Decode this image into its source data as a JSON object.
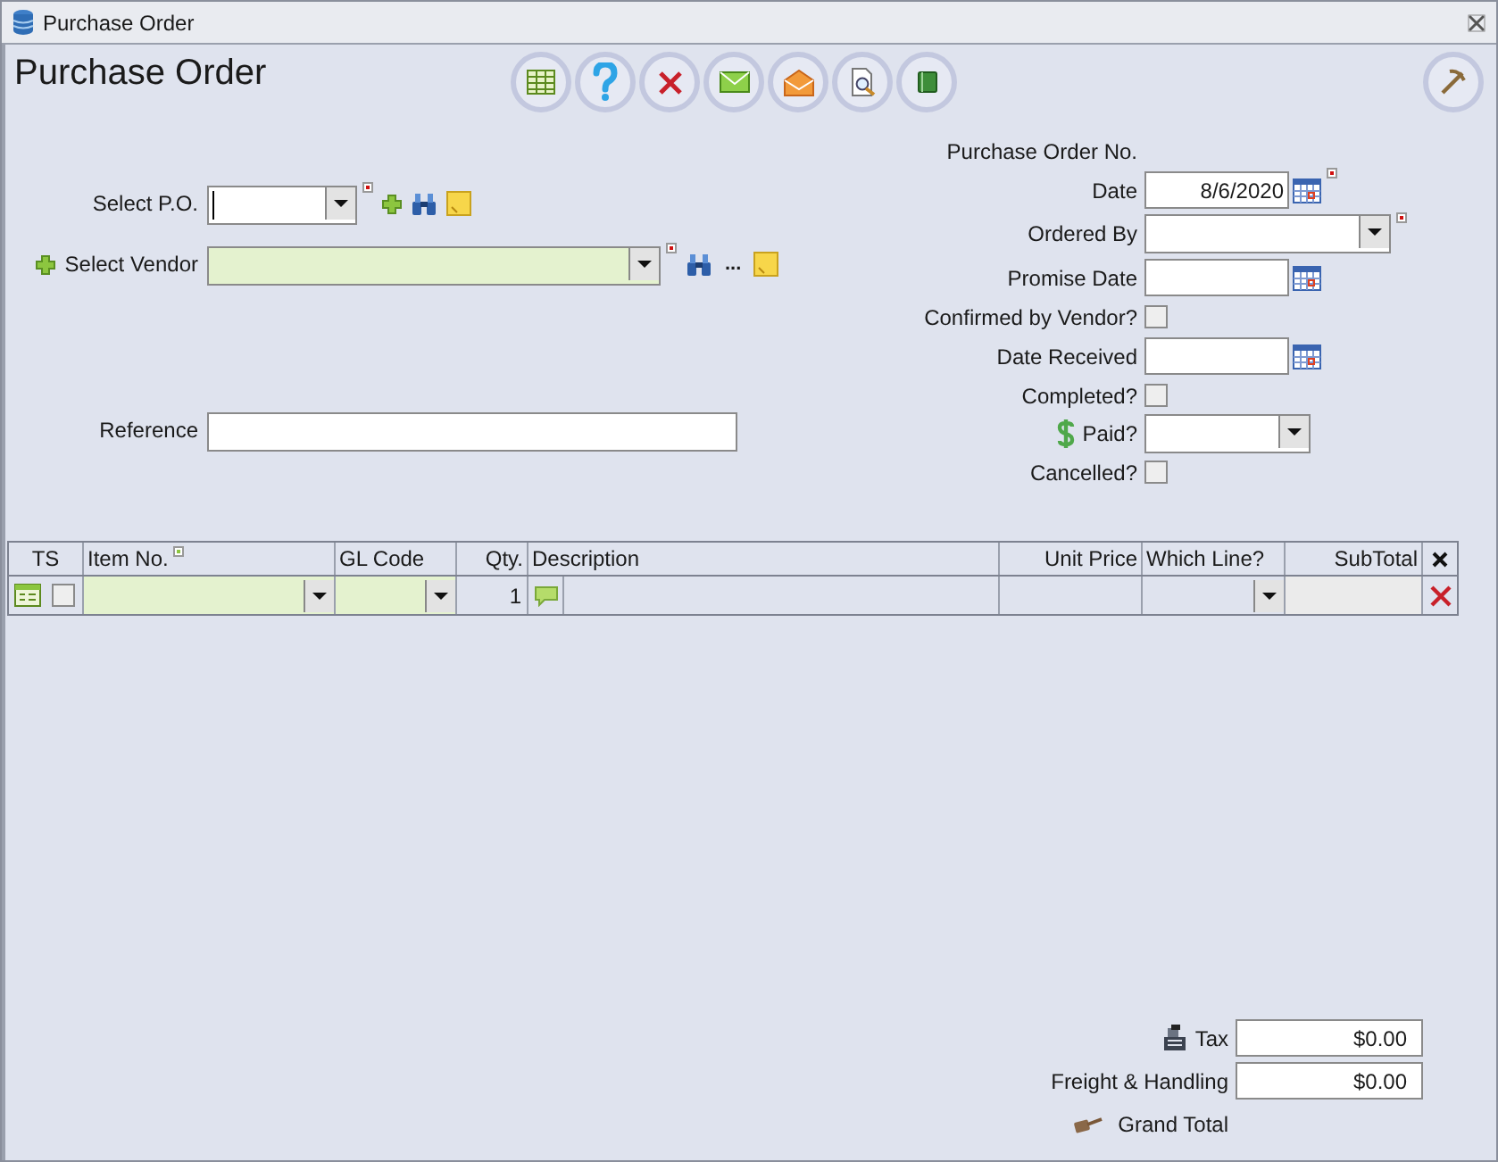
{
  "window": {
    "title": "Purchase Order"
  },
  "header": {
    "title": "Purchase Order"
  },
  "left_fields": [
    {
      "label": "Select P.O.",
      "kind": "combo",
      "required": true,
      "highlighted": false
    },
    {
      "label": "Select Vendor",
      "kind": "combo",
      "required": true,
      "highlighted": true,
      "more": "..."
    },
    {
      "label": "Reference",
      "kind": "text",
      "required": false,
      "highlighted": false
    }
  ],
  "right_fields": [
    {
      "label": "Purchase Order No.",
      "kind": "caption"
    },
    {
      "label": "Date",
      "kind": "date",
      "value": "8/6/2020",
      "required": true
    },
    {
      "label": "Ordered By",
      "kind": "combo",
      "required": true
    },
    {
      "label": "Promise Date",
      "kind": "date",
      "required": false
    },
    {
      "label": "Confirmed by Vendor?",
      "kind": "checkbox",
      "checked": false
    },
    {
      "label": "Date Received",
      "kind": "date",
      "required": false
    },
    {
      "label": "Completed?",
      "kind": "checkbox",
      "checked": false
    },
    {
      "label": "Paid?",
      "kind": "combo",
      "required": false
    },
    {
      "label": "Cancelled?",
      "kind": "checkbox",
      "checked": false
    }
  ],
  "grid": {
    "columns": [
      "TS",
      "Item No.",
      "GL Code",
      "Qty.",
      "Description",
      "Unit Price",
      "Which Line?",
      "SubTotal"
    ],
    "rows": [
      {
        "checked": false,
        "qty": "1"
      }
    ]
  },
  "totals": [
    {
      "label": "Tax",
      "value": "$0.00"
    },
    {
      "label": "Freight & Handling",
      "value": "$0.00"
    },
    {
      "label": "Grand Total"
    }
  ]
}
